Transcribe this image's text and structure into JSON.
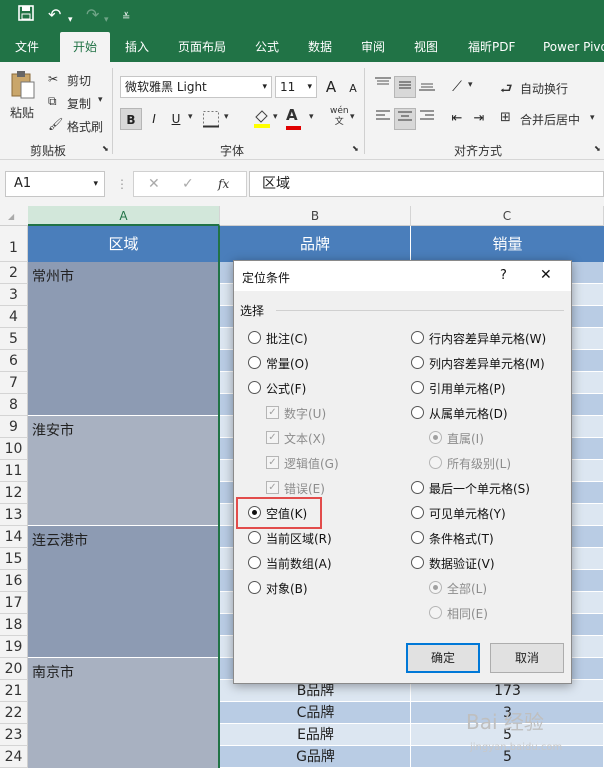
{
  "qat": {
    "save_icon": "save-icon",
    "undo_icon": "undo-icon",
    "redo_icon": "redo-icon",
    "customize_icon": "customize-icon"
  },
  "tabs": [
    "文件",
    "开始",
    "插入",
    "页面布局",
    "公式",
    "数据",
    "审阅",
    "视图",
    "福昕PDF",
    "Power Pivot"
  ],
  "active_tab": "开始",
  "ribbon": {
    "paste": "粘贴",
    "cut": "剪切",
    "copy": "复制",
    "format_painter": "格式刷",
    "clipboard_group": "剪贴板",
    "font_name": "微软雅黑 Light",
    "font_size": "11",
    "grow_font": "A",
    "shrink_font": "A",
    "bold": "B",
    "italic": "I",
    "underline": "U",
    "phonetic": "wén\n文",
    "font_group": "字体",
    "wrap_text": "自动换行",
    "merge_center": "合并后居中",
    "alignment_group": "对齐方式"
  },
  "formula_bar": {
    "name_box": "A1",
    "fx": "fx",
    "cancel": "✕",
    "confirm": "✓",
    "value": "区域"
  },
  "columns": [
    "A",
    "B",
    "C"
  ],
  "rows": [
    "1",
    "2",
    "3",
    "4",
    "5",
    "6",
    "7",
    "8",
    "9",
    "10",
    "11",
    "12",
    "13",
    "14",
    "15",
    "16",
    "17",
    "18",
    "19",
    "20",
    "21",
    "22",
    "23",
    "24"
  ],
  "headers": {
    "a": "区域",
    "b": "品牌",
    "c": "销量"
  },
  "regions": [
    "常州市",
    "淮安市",
    "连云港市",
    "南京市"
  ],
  "visible_rows": [
    {
      "brand": "B品牌",
      "sales": "173"
    },
    {
      "brand": "C品牌",
      "sales": "3"
    },
    {
      "brand": "E品牌",
      "sales": "5"
    },
    {
      "brand": "G品牌",
      "sales": "5"
    }
  ],
  "dialog": {
    "title": "定位条件",
    "help": "?",
    "close": "✕",
    "section": "选择",
    "left": [
      {
        "label": "批注(C)",
        "disabled": false,
        "checked": false
      },
      {
        "label": "常量(O)",
        "disabled": false,
        "checked": false
      },
      {
        "label": "公式(F)",
        "disabled": false,
        "checked": false
      },
      {
        "label": "数字(U)",
        "disabled": true,
        "type": "check"
      },
      {
        "label": "文本(X)",
        "disabled": true,
        "type": "check"
      },
      {
        "label": "逻辑值(G)",
        "disabled": true,
        "type": "check"
      },
      {
        "label": "错误(E)",
        "disabled": true,
        "type": "check"
      },
      {
        "label": "空值(K)",
        "disabled": false,
        "checked": true
      },
      {
        "label": "当前区域(R)",
        "disabled": false,
        "checked": false
      },
      {
        "label": "当前数组(A)",
        "disabled": false,
        "checked": false
      },
      {
        "label": "对象(B)",
        "disabled": false,
        "checked": false
      }
    ],
    "right": [
      {
        "label": "行内容差异单元格(W)",
        "disabled": false,
        "checked": false
      },
      {
        "label": "列内容差异单元格(M)",
        "disabled": false,
        "checked": false
      },
      {
        "label": "引用单元格(P)",
        "disabled": false,
        "checked": false
      },
      {
        "label": "从属单元格(D)",
        "disabled": false,
        "checked": false
      },
      {
        "label": "直属(I)",
        "disabled": true,
        "checked": true
      },
      {
        "label": "所有级别(L)",
        "disabled": true,
        "checked": false
      },
      {
        "label": "最后一个单元格(S)",
        "disabled": false,
        "checked": false
      },
      {
        "label": "可见单元格(Y)",
        "disabled": false,
        "checked": false
      },
      {
        "label": "条件格式(T)",
        "disabled": false,
        "checked": false
      },
      {
        "label": "数据验证(V)",
        "disabled": false,
        "checked": false
      },
      {
        "label": "全部(L)",
        "disabled": true,
        "checked": true
      },
      {
        "label": "相同(E)",
        "disabled": true,
        "checked": false
      }
    ],
    "ok": "确定",
    "cancel": "取消"
  },
  "watermark": {
    "text": "Bai 经验",
    "sub": "jingyan.baidu.com"
  },
  "colors": {
    "excel_green": "#217346",
    "header_blue": "#4a7ebb",
    "region_gray": "#8d9bb3",
    "stripe_light": "#dce6f1",
    "stripe_mid": "#b9cce4",
    "highlight_red": "#e24c4b",
    "focus_blue": "#0078d7"
  }
}
